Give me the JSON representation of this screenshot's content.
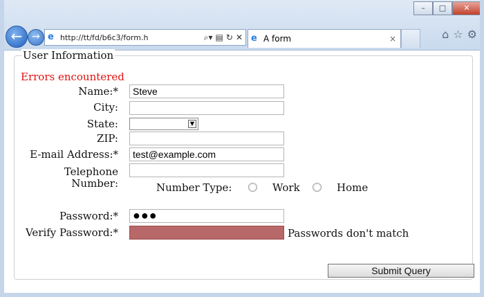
{
  "browser": {
    "url": "http://tt/fd/b6c3/form.h",
    "tab_title": "A form",
    "tab_close": "×",
    "window_buttons": {
      "minimize": "–",
      "maximize": "□",
      "close": "✕"
    },
    "back_glyph": "←",
    "forward_glyph": "→",
    "address_icons": [
      "search-dropdown-icon",
      "compatibility-icon",
      "refresh-icon",
      "stop-icon"
    ],
    "tools_icons": [
      "home-icon",
      "favorites-icon",
      "gear-icon"
    ]
  },
  "form": {
    "legend": "User Information",
    "error_message": "Errors encountered",
    "name_label": "Name:*",
    "name_value": "Steve",
    "city_label": "City:",
    "city_value": "",
    "state_label": "State:",
    "state_value": "",
    "zip_label": "ZIP:",
    "zip_value": "",
    "email_label": "E-mail Address:*",
    "email_value": "test@example.com",
    "phone_label_line1": "Telephone",
    "phone_label_line2": "Number:",
    "phone_value": "",
    "number_type_label": "Number Type:",
    "number_type_options": [
      "Work",
      "Home"
    ],
    "password_label": "Password:*",
    "password_value": "●●●",
    "verify_password_label": "Verify Password:*",
    "verify_password_value": "",
    "verify_error": "Passwords don't match",
    "submit_label": "Submit Query"
  },
  "colors": {
    "error_text": "#e01010",
    "invalid_field": "#b86868"
  }
}
